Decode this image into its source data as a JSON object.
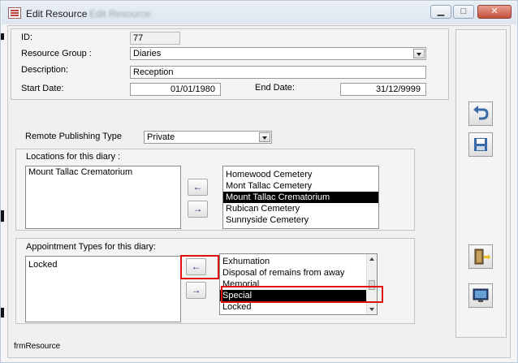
{
  "window": {
    "title": "Edit Resource",
    "title_ghost": "Edit Resource",
    "minimize_glyph": "▁",
    "maximize_glyph": "□",
    "close_glyph": "✕"
  },
  "details": {
    "id_label": "ID:",
    "id_value": "77",
    "group_label": "Resource Group :",
    "group_value": "Diaries",
    "description_label": "Description:",
    "description_value": "Reception",
    "start_label": "Start Date:",
    "start_value": "01/01/1980",
    "end_label": "End Date:",
    "end_value": "31/12/9999"
  },
  "publishing": {
    "label": "Remote Publishing Type",
    "value": "Private"
  },
  "locations": {
    "title": "Locations for this diary :",
    "selected": [
      "Mount Tallac Crematorium"
    ],
    "available": [
      "Homewood Cemetery",
      "Mont Tallac Cemetery",
      "Mount Tallac Crematorium",
      "Rubican Cemetery",
      "Sunnyside Cemetery"
    ],
    "highlighted_index": 2,
    "add_glyph": "←",
    "remove_glyph": "→"
  },
  "appointments": {
    "title": "Appointment Types for this diary:",
    "selected": [
      "Locked"
    ],
    "available": [
      "Exhumation",
      "Disposal of remains from away",
      "Memorial",
      "Special",
      "Locked"
    ],
    "highlighted_index": 3,
    "add_glyph": "←",
    "remove_glyph": "→"
  },
  "toolbar": {
    "icons": [
      "undo-icon",
      "save-icon",
      "exit-door-icon",
      "monitor-icon"
    ]
  },
  "footer": {
    "form_name": "frmResource"
  },
  "colors": {
    "highlight": "#e01010",
    "selection": "#000000",
    "arrow": "#1a2a7a"
  }
}
